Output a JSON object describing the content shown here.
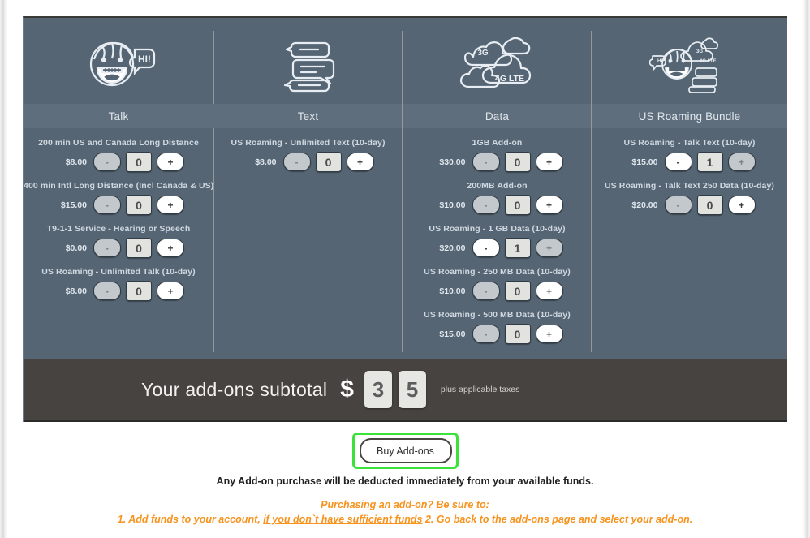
{
  "columns": [
    {
      "name": "Talk",
      "icon": "talking-face-icon",
      "items": [
        {
          "title": "200 min US and Canada Long Distance",
          "price": "$8.00",
          "qty": "0",
          "minus": "-",
          "plus": "+"
        },
        {
          "title": "400 min Intl Long Distance (Incl Canada & US)",
          "price": "$15.00",
          "qty": "0",
          "minus": "-",
          "plus": "+"
        },
        {
          "title": "T9-1-1 Service - Hearing or Speech",
          "price": "$0.00",
          "qty": "0",
          "minus": "-",
          "plus": "+"
        },
        {
          "title": "US Roaming - Unlimited Talk (10-day)",
          "price": "$8.00",
          "qty": "0",
          "minus": "-",
          "plus": "+"
        }
      ]
    },
    {
      "name": "Text",
      "icon": "speech-bubbles-icon",
      "items": [
        {
          "title": "US Roaming - Unlimited Text (10-day)",
          "price": "$8.00",
          "qty": "0",
          "minus": "-",
          "plus": "+"
        }
      ]
    },
    {
      "name": "Data",
      "icon": "data-clouds-icon",
      "items": [
        {
          "title": "1GB Add-on",
          "price": "$30.00",
          "qty": "0",
          "minus": "-",
          "plus": "+"
        },
        {
          "title": "200MB Add-on",
          "price": "$10.00",
          "qty": "0",
          "minus": "-",
          "plus": "+"
        },
        {
          "title": "US Roaming - 1 GB Data (10-day)",
          "price": "$20.00",
          "qty": "1",
          "minus": "-",
          "plus": "+"
        },
        {
          "title": "US Roaming - 250 MB Data (10-day)",
          "price": "$10.00",
          "qty": "0",
          "minus": "-",
          "plus": "+"
        },
        {
          "title": "US Roaming - 500 MB Data (10-day)",
          "price": "$15.00",
          "qty": "0",
          "minus": "-",
          "plus": "+"
        }
      ]
    },
    {
      "name": "US Roaming Bundle",
      "icon": "roaming-bundle-icon",
      "items": [
        {
          "title": "US Roaming - Talk Text (10-day)",
          "price": "$15.00",
          "qty": "1",
          "minus": "-",
          "plus": "+"
        },
        {
          "title": "US Roaming - Talk Text 250 Data (10-day)",
          "price": "$20.00",
          "qty": "0",
          "minus": "-",
          "plus": "+"
        }
      ]
    }
  ],
  "subtotal": {
    "label": "Your add-ons subtotal",
    "currency_symbol": "$",
    "digits": [
      "3",
      "5"
    ],
    "taxes_note": "plus applicable taxes"
  },
  "buy_button": {
    "label": "Buy Add-ons"
  },
  "footer": {
    "note": "Any Add-on purchase will be deducted immediately from your available funds.",
    "promo_line1": "Purchasing an add-on? Be sure to:",
    "promo_line2_pre": "1. Add funds to your account, ",
    "promo_line2_link": "if you don`t have sufficient funds",
    "promo_line2_post": "  2. Go back to the add-ons page and select your add-on."
  },
  "icon_labels": {
    "talk_bubble": "HI!",
    "net_3g": "3G",
    "net_4g": "4G LTE"
  },
  "colors": {
    "panel": "#566573",
    "header_band": "#5f6e7c",
    "subtotal_bar": "#474340",
    "highlight_green": "#3ae23a",
    "promo_orange": "#f7931e"
  }
}
